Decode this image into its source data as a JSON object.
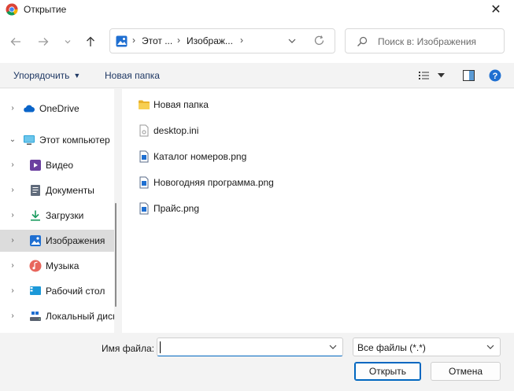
{
  "window": {
    "title": "Открытие",
    "close_glyph": "✕"
  },
  "nav": {
    "back_icon": "arrow-left-icon",
    "forward_icon": "arrow-right-icon",
    "recent_icon": "chevron-down-icon",
    "up_icon": "arrow-up-icon"
  },
  "address": {
    "crumbs": [
      "Этот ...",
      "Изображ..."
    ],
    "separator": "›"
  },
  "search": {
    "placeholder": "Поиск в: Изображения"
  },
  "toolbar": {
    "organize": "Упорядочить",
    "new_folder": "Новая папка"
  },
  "sidebar": {
    "items": [
      {
        "label": "OneDrive",
        "expand": "›",
        "icon": "cloud-icon"
      },
      {
        "label": "Этот компьютер",
        "expand": "⌄",
        "icon": "monitor-icon"
      },
      {
        "label": "Видео",
        "expand": "›",
        "icon": "video-icon"
      },
      {
        "label": "Документы",
        "expand": "›",
        "icon": "document-icon"
      },
      {
        "label": "Загрузки",
        "expand": "›",
        "icon": "download-icon"
      },
      {
        "label": "Изображения",
        "expand": "›",
        "icon": "picture-icon",
        "selected": true
      },
      {
        "label": "Музыка",
        "expand": "›",
        "icon": "music-icon"
      },
      {
        "label": "Рабочий стол",
        "expand": "›",
        "icon": "desktop-icon"
      },
      {
        "label": "Локальный диск",
        "expand": "›",
        "icon": "drive-icon"
      }
    ]
  },
  "files": [
    {
      "name": "Новая папка",
      "type": "folder"
    },
    {
      "name": "desktop.ini",
      "type": "ini"
    },
    {
      "name": "Каталог номеров.png",
      "type": "png"
    },
    {
      "name": "Новогодняя программа.png",
      "type": "png"
    },
    {
      "name": "Прайс.png",
      "type": "png"
    }
  ],
  "bottom": {
    "filename_label": "Имя файла:",
    "filename_value": "",
    "filetype": "Все файлы (*.*)",
    "open": "Открыть",
    "cancel": "Отмена"
  },
  "colors": {
    "accent": "#0067c0",
    "folder": "#f3c13a",
    "selected_bg": "#dcdcdc"
  }
}
